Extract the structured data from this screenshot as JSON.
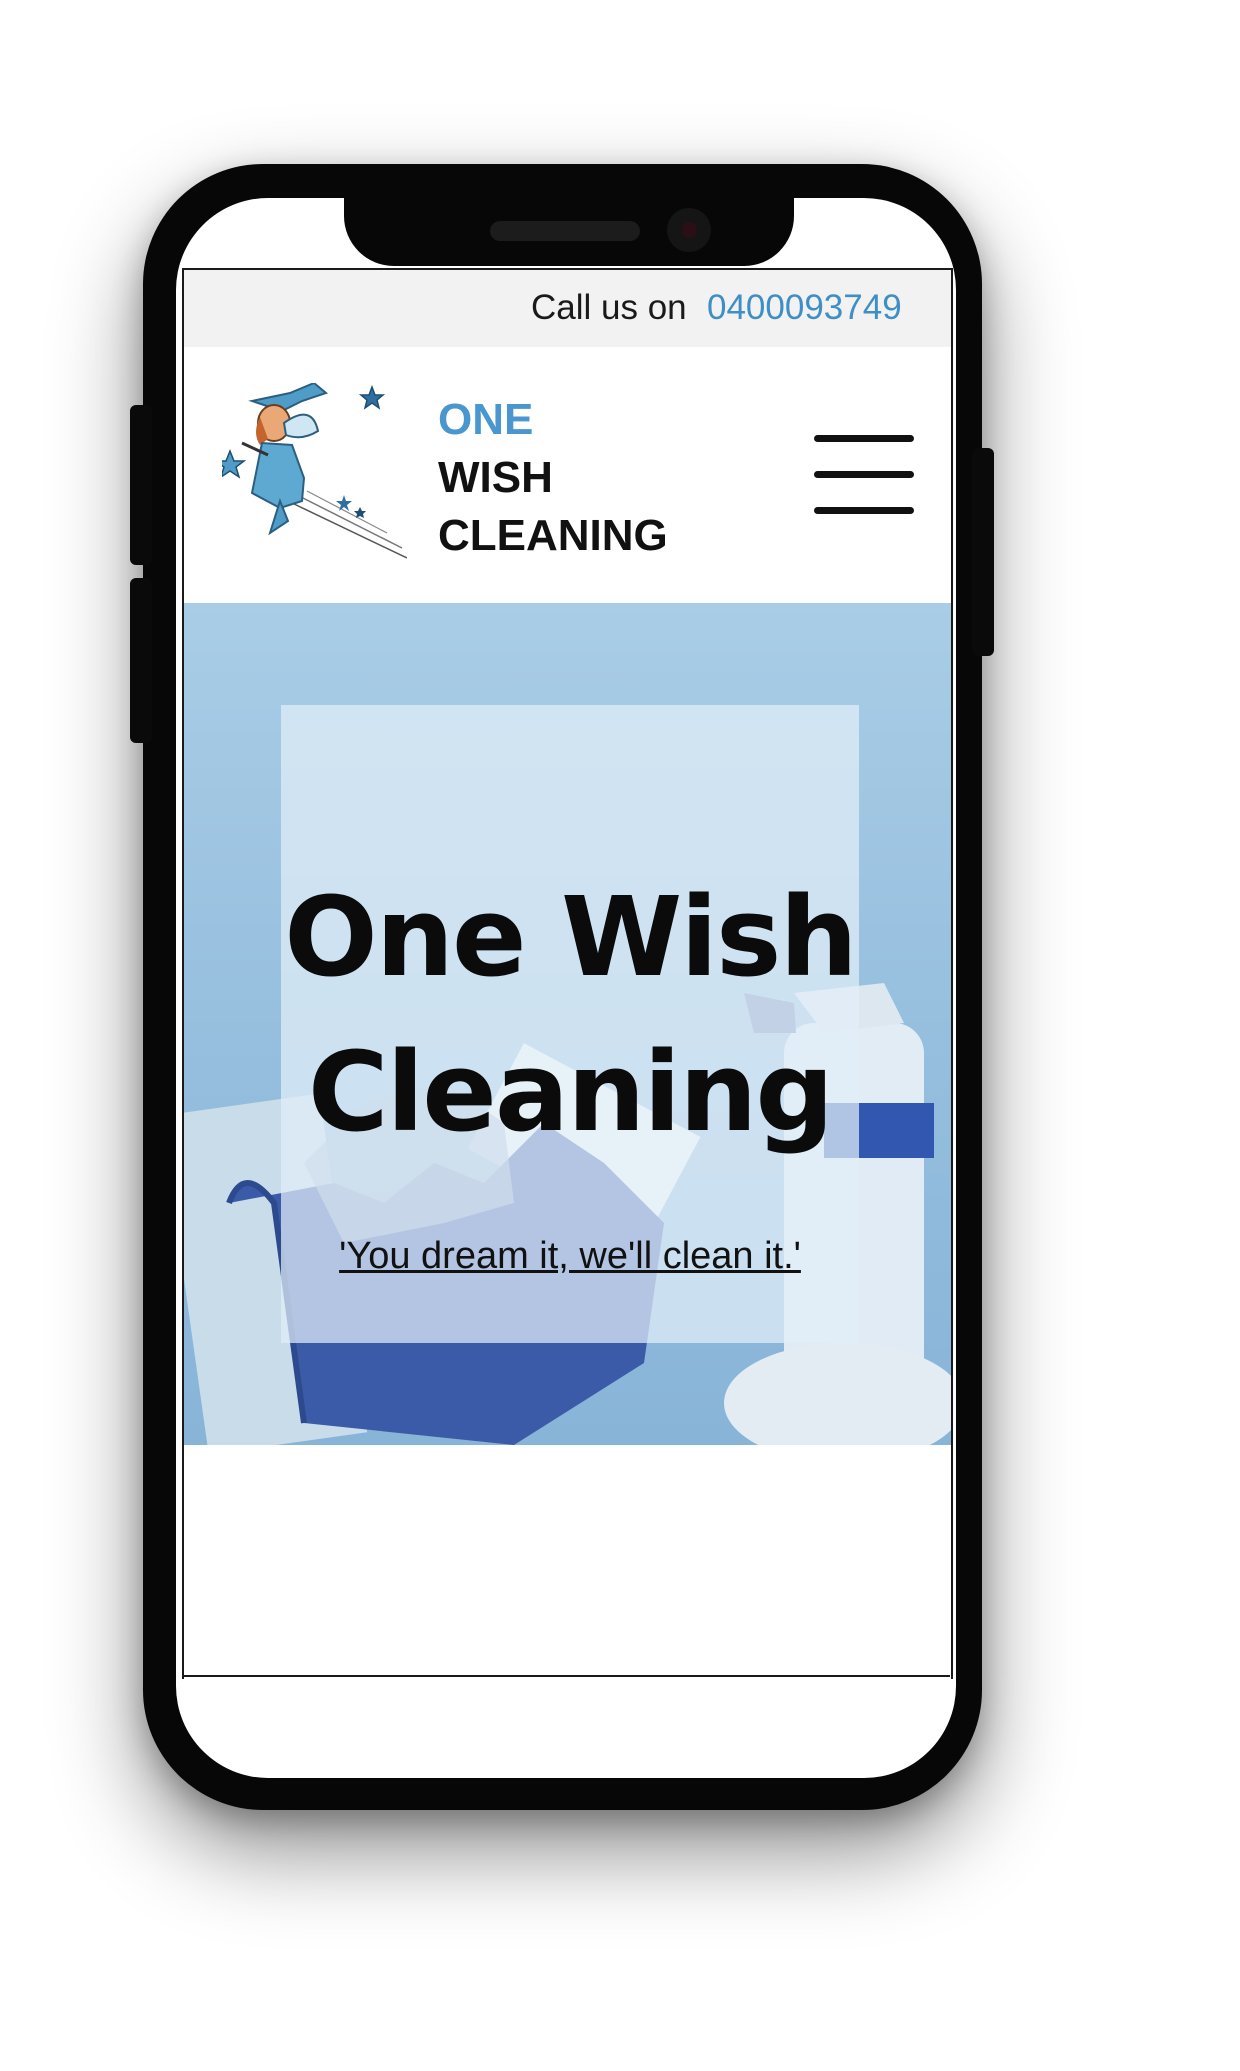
{
  "topbar": {
    "call_label": "Call us on",
    "phone_number": "0400093749"
  },
  "header": {
    "logo_line1": "ONE",
    "logo_line2": "WISH",
    "logo_line3": "CLEANING",
    "menu_icon": "hamburger-menu-icon"
  },
  "hero": {
    "title_line1": "One Wish",
    "title_line2": "Cleaning",
    "tagline": "'You dream it, we'll clean it.'"
  },
  "colors": {
    "accent": "#4a96cf",
    "phone_link": "#3f8fc7",
    "hero_bg": "#a9cde6",
    "topbar_bg": "#f2f2f2"
  }
}
